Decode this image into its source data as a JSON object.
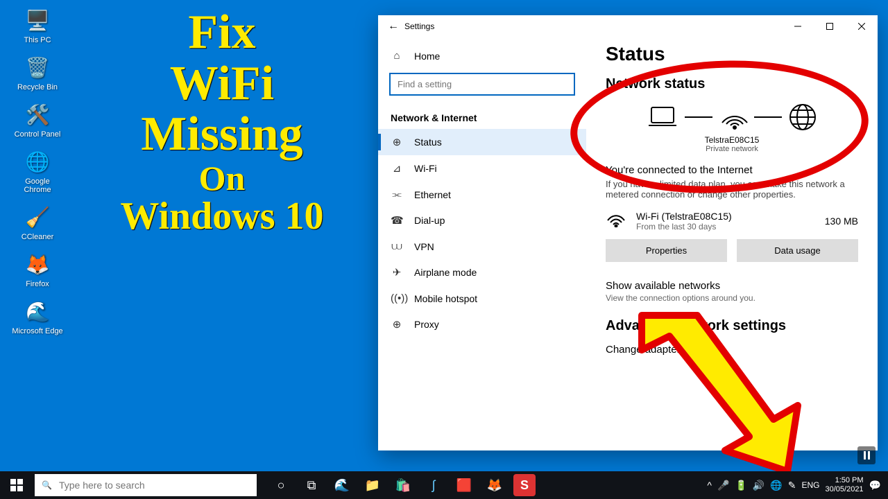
{
  "desktop": {
    "icons": [
      {
        "label": "This PC",
        "glyph": "🖥️"
      },
      {
        "label": "Recycle Bin",
        "glyph": "🗑️"
      },
      {
        "label": "Control Panel",
        "glyph": "🛠️"
      },
      {
        "label": "Google Chrome",
        "glyph": "🌐"
      },
      {
        "label": "CCleaner",
        "glyph": "🧹"
      },
      {
        "label": "Firefox",
        "glyph": "🦊"
      },
      {
        "label": "Microsoft Edge",
        "glyph": "🌊"
      }
    ]
  },
  "overlay": {
    "l1": "Fix",
    "l2": "WiFi",
    "l3": "Missing",
    "l4": "On",
    "l5": "Windows 10"
  },
  "window": {
    "title": "Settings",
    "sidebar": {
      "home": "Home",
      "search_placeholder": "Find a setting",
      "category": "Network & Internet",
      "items": [
        {
          "icon": "⊕",
          "label": "Status",
          "selected": true
        },
        {
          "icon": "⊿",
          "label": "Wi-Fi"
        },
        {
          "icon": "⫘",
          "label": "Ethernet"
        },
        {
          "icon": "☎",
          "label": "Dial-up"
        },
        {
          "icon": "⩊",
          "label": "VPN"
        },
        {
          "icon": "✈",
          "label": "Airplane mode"
        },
        {
          "icon": "((•))",
          "label": "Mobile hotspot"
        },
        {
          "icon": "⊕",
          "label": "Proxy"
        }
      ]
    },
    "main": {
      "heading": "Status",
      "section": "Network status",
      "ssid": "TelstraE08C15",
      "nettype": "Private network",
      "connected": "You're connected to the Internet",
      "desc": "If you have a limited data plan, you can make this network a metered connection or change other properties.",
      "adapter": "Wi-Fi (TelstraE08C15)",
      "adapter_sub": "From the last 30 days",
      "usage": "130 MB",
      "btn_properties": "Properties",
      "btn_datausage": "Data usage",
      "show_networks": "Show available networks",
      "show_networks_sub": "View the connection options around you.",
      "adv": "Advanced network settings",
      "change": "Change adapter options"
    }
  },
  "taskbar": {
    "search_placeholder": "Type here to search",
    "lang": "ENG",
    "time": "1:50 PM",
    "date": "30/05/2021"
  }
}
